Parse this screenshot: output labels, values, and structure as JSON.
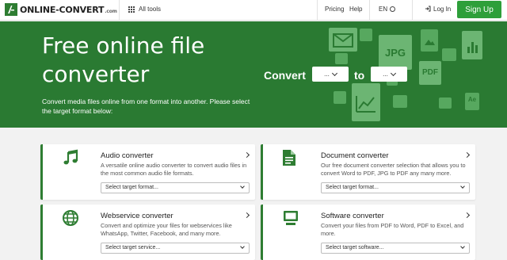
{
  "header": {
    "logo_text": "ONLINE-CONVERT",
    "logo_suffix": ".com",
    "all_tools": "All tools",
    "pricing": "Pricing",
    "help": "Help",
    "language": "EN",
    "login": "Log In",
    "signup": "Sign Up"
  },
  "hero": {
    "title": "Free online file converter",
    "subtitle": "Convert media files online from one format into another. Please select the target format below:",
    "convert_label": "Convert",
    "to_label": "to",
    "from_value": "...",
    "to_value": "...",
    "deco_jpg": "JPG",
    "deco_pdf": "PDF",
    "deco_ae": "Ae"
  },
  "cards": [
    {
      "title": "Audio converter",
      "desc": "A versatile online audio converter to convert audio files in the most common audio file formats.",
      "select": "Select target format...",
      "icon": "music-note-icon"
    },
    {
      "title": "Document converter",
      "desc": "Our free document converter selection that allows you to convert Word to PDF, JPG to PDF any many more.",
      "select": "Select target format...",
      "icon": "document-icon"
    },
    {
      "title": "Webservice converter",
      "desc": "Convert and optimize your files for webservices like WhatsApp, Twitter, Facebook, and many more.",
      "select": "Select target service...",
      "icon": "globe-icon"
    },
    {
      "title": "Software converter",
      "desc": "Convert your files from PDF to Word, PDF to Excel, and more.",
      "select": "Select target software...",
      "icon": "monitor-icon"
    }
  ],
  "colors": {
    "brand_green": "#2a7a32",
    "signup_green": "#2e9f3a"
  }
}
